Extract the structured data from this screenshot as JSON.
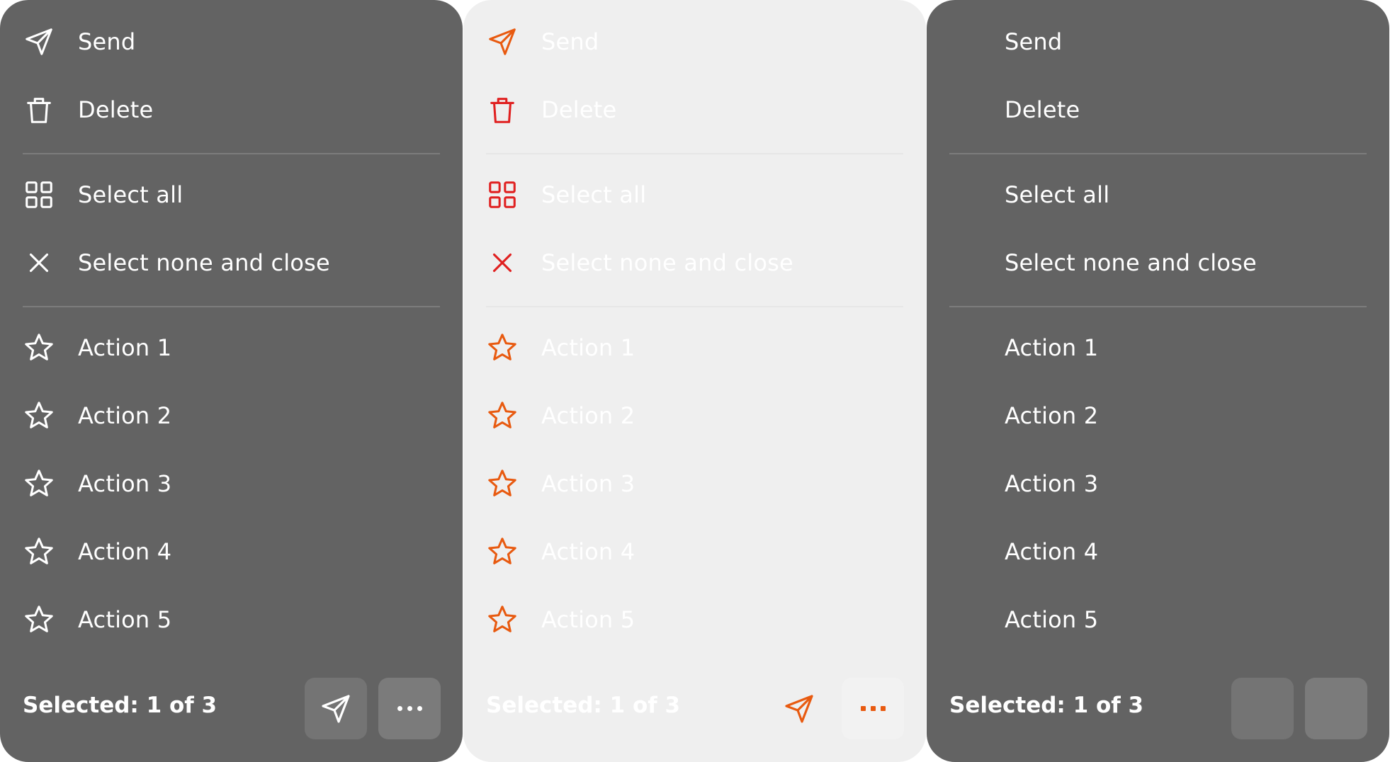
{
  "colors": {
    "dark_panel": "#636363",
    "light_panel": "#efefef",
    "accent_orange": "#e85a10",
    "accent_red": "#e02020"
  },
  "menu": {
    "send": "Send",
    "delete": "Delete",
    "select_all": "Select all",
    "select_none": "Select none and close",
    "action1": "Action 1",
    "action2": "Action 2",
    "action3": "Action 3",
    "action4": "Action 4",
    "action5": "Action 5"
  },
  "footer": {
    "selected_text": "Selected: 1 of 3"
  },
  "icons": {
    "send": "send-icon",
    "delete": "trash-icon",
    "select_all": "grid-icon",
    "select_none": "close-icon",
    "action": "star-icon",
    "more": "more-icon"
  }
}
